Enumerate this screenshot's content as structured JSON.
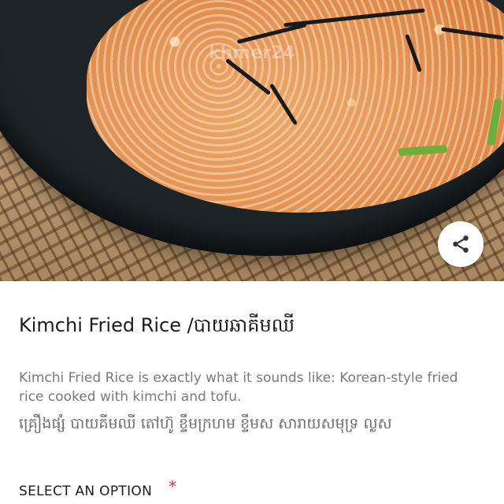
{
  "hero": {
    "image_icon": "food-photo",
    "watermark": "khmer24",
    "share_icon": "share-icon"
  },
  "product": {
    "title": "Kimchi Fried Rice /បាយឆាគីមឈី",
    "description": "Kimchi Fried Rice is exactly what it sounds like: Korean-style fried rice cooked with kimchi and tofu.",
    "ingredients_khmer": "គ្រឿងផ្សំ បាយគីមឈី តៅហ៊ូ ខ្ទឹមក្រហម ខ្ទឹមស សារាយសមុទ្រ ល្ងស"
  },
  "options": {
    "label": "SELECT AN OPTION",
    "required_mark": "*"
  },
  "colors": {
    "required": "#e02a3b",
    "title": "#1c1c1c",
    "description": "#7a7a7a"
  }
}
